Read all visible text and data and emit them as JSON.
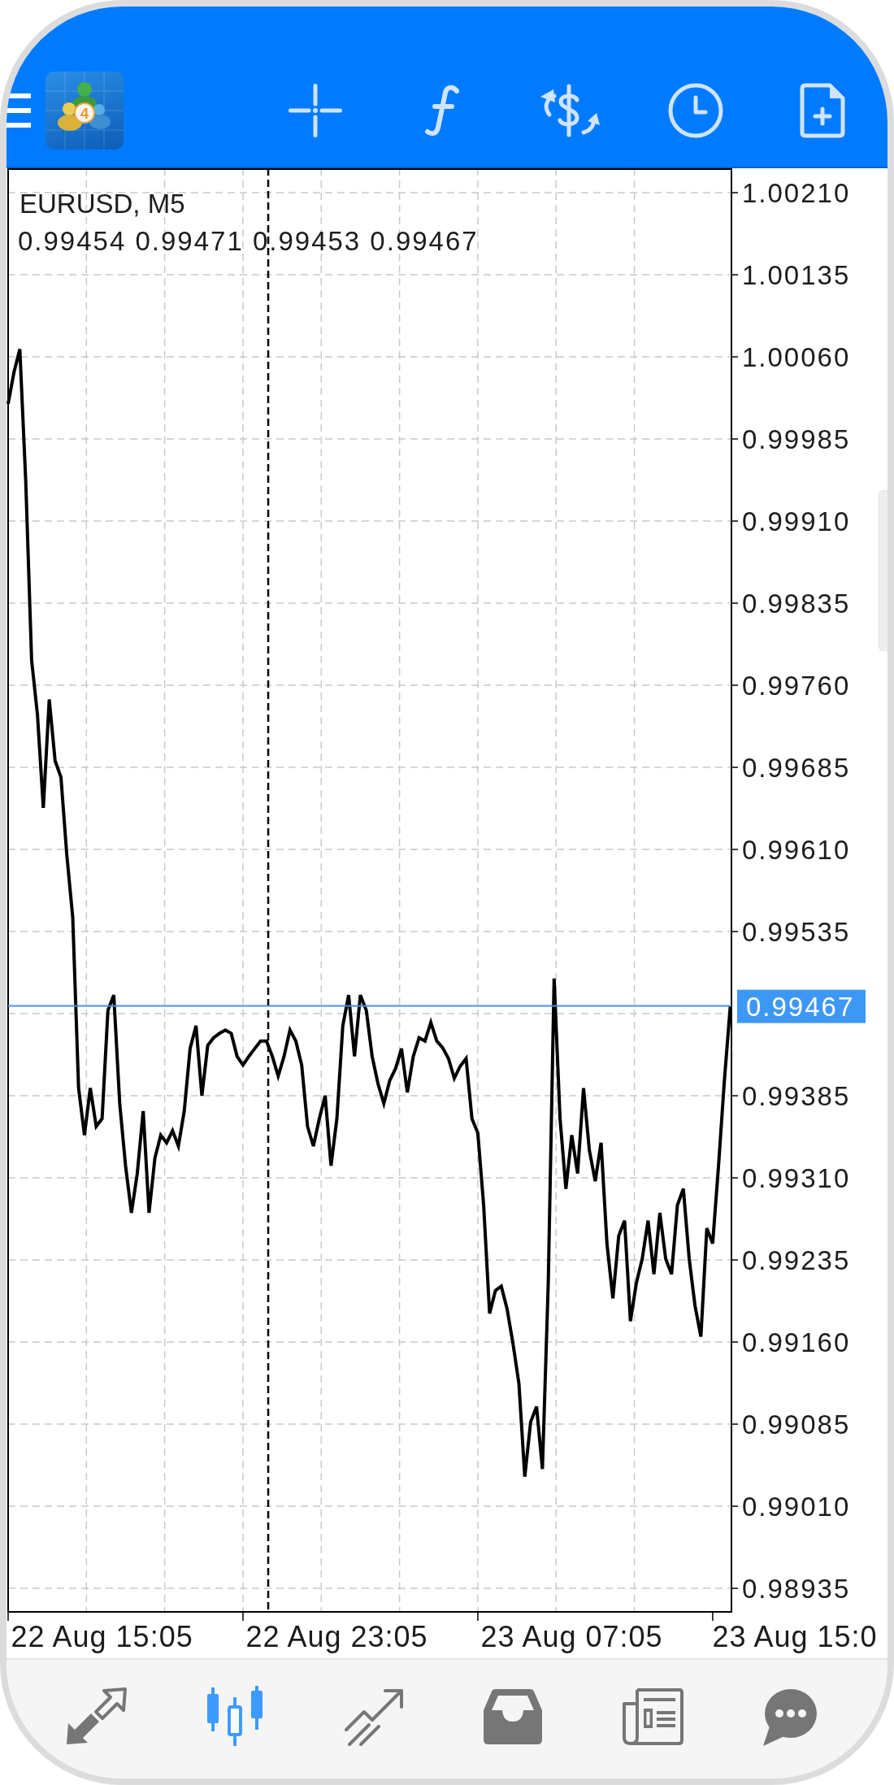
{
  "header": {
    "app_logo": {
      "badge": "4"
    }
  },
  "chart": {
    "ohlc_label": "0.99454 0.99471 0.99453 0.99467",
    "chart_data": {
      "type": "line",
      "title": "EURUSD, M5",
      "grid": true,
      "categories": [
        null,
        null,
        null,
        null,
        null,
        null,
        null,
        null,
        null,
        null,
        null,
        null,
        null,
        null,
        null,
        null,
        "22 Aug 15:05",
        null,
        null,
        null,
        null,
        null,
        null,
        null,
        null,
        null,
        null,
        null,
        null,
        null,
        null,
        null,
        null,
        null,
        null,
        null,
        null,
        null,
        null,
        null,
        null,
        null,
        null,
        null,
        null,
        null,
        null,
        null,
        null,
        null,
        null,
        null,
        null,
        null,
        null,
        null,
        "22 Aug 23:05",
        null,
        null,
        null,
        null,
        null,
        null,
        null,
        null,
        null,
        null,
        null,
        null,
        null,
        null,
        null,
        null,
        null,
        null,
        null,
        null,
        null,
        null,
        null,
        null,
        null,
        null,
        null,
        null,
        null,
        null,
        null,
        null,
        null,
        null,
        null,
        null,
        null,
        null,
        null,
        "23 Aug 07:05",
        null,
        null,
        null,
        null,
        null,
        null,
        null,
        null,
        null,
        null,
        null,
        null,
        null,
        null,
        null,
        null,
        null,
        null,
        null,
        null,
        null,
        null,
        null,
        null,
        null,
        null,
        null,
        null,
        null,
        null,
        null,
        null,
        null,
        null,
        null,
        null,
        null,
        "23 Aug 15:0"
      ],
      "series": [
        {
          "color": "#000000",
          "values": [
            1.00017,
            1.00046,
            1.00067,
            0.99946,
            0.99783,
            0.99733,
            0.99648,
            0.99747,
            0.99691,
            0.99676,
            0.99605,
            0.99548,
            0.99392,
            0.99349,
            0.99392,
            0.99357,
            0.99364,
            0.99463,
            0.99477,
            0.99378,
            0.99321,
            0.99278,
            0.99314,
            0.99371,
            0.99278,
            0.99328,
            0.99349,
            0.99342,
            0.99353,
            0.99339,
            0.99371,
            0.99428,
            0.99449,
            0.99385,
            0.99431,
            0.99438,
            0.99442,
            0.99445,
            0.99442,
            0.99421,
            0.99413,
            0.99421,
            0.99428,
            0.99435,
            0.99435,
            0.99421,
            0.99403,
            0.99421,
            0.99445,
            0.99435,
            0.99413,
            0.99357,
            0.99339,
            0.99364,
            0.99385,
            0.99321,
            0.99364,
            0.99449,
            0.99477,
            0.99421,
            0.99477,
            0.99463,
            0.99421,
            0.99396,
            0.99378,
            0.99399,
            0.9941,
            0.99428,
            0.99388,
            0.99421,
            0.99438,
            0.99435,
            0.99452,
            0.99435,
            0.99429,
            0.99419,
            0.99401,
            0.99412,
            0.99419,
            0.99364,
            0.99351,
            0.99285,
            0.99186,
            0.99207,
            0.99211,
            0.9919,
            0.99158,
            0.99122,
            0.99037,
            0.99087,
            0.99101,
            0.99044,
            0.99214,
            0.99492,
            0.99364,
            0.993,
            0.99349,
            0.99314,
            0.99392,
            0.99335,
            0.99307,
            0.99342,
            0.9925,
            0.992,
            0.99257,
            0.99271,
            0.99179,
            0.99214,
            0.99236,
            0.99271,
            0.99222,
            0.99278,
            0.99236,
            0.99222,
            0.99285,
            0.993,
            0.99236,
            0.99193,
            0.99165,
            0.99264,
            0.9925,
            0.99321,
            0.99399,
            0.99467,
            null,
            null,
            null,
            null,
            null,
            null,
            null,
            null,
            null,
            null,
            null
          ]
        }
      ],
      "ylim": [
        0.989135,
        1.002323
      ],
      "yticks": [
        {
          "value": 1.0021,
          "label": "1.00210"
        },
        {
          "value": 1.00135,
          "label": "1.00135"
        },
        {
          "value": 1.0006,
          "label": "1.00060"
        },
        {
          "value": 0.99985,
          "label": "0.99985"
        },
        {
          "value": 0.9991,
          "label": "0.99910"
        },
        {
          "value": 0.99835,
          "label": "0.99835"
        },
        {
          "value": 0.9976,
          "label": "0.99760"
        },
        {
          "value": 0.99685,
          "label": "0.99685"
        },
        {
          "value": 0.9961,
          "label": "0.99610"
        },
        {
          "value": 0.99535,
          "label": "0.99535"
        },
        {
          "value": 0.99385,
          "label": "0.99385"
        },
        {
          "value": 0.9931,
          "label": "0.99310"
        },
        {
          "value": 0.99235,
          "label": "0.99235"
        },
        {
          "value": 0.9916,
          "label": "0.99160"
        },
        {
          "value": 0.99085,
          "label": "0.99085"
        },
        {
          "value": 0.9901,
          "label": "0.99010"
        },
        {
          "value": 0.98935,
          "label": "0.98935"
        }
      ],
      "ref_lines": [
        {
          "axis": "y",
          "value": 0.99467,
          "label": "0.99467"
        }
      ]
    }
  },
  "bottom_nav": [
    {
      "kind": "trade",
      "selected": false
    },
    {
      "kind": "chart",
      "selected": true
    },
    {
      "kind": "history",
      "selected": false
    },
    {
      "kind": "mailbox",
      "selected": false
    },
    {
      "kind": "news",
      "selected": false
    },
    {
      "kind": "chat",
      "selected": false
    }
  ]
}
